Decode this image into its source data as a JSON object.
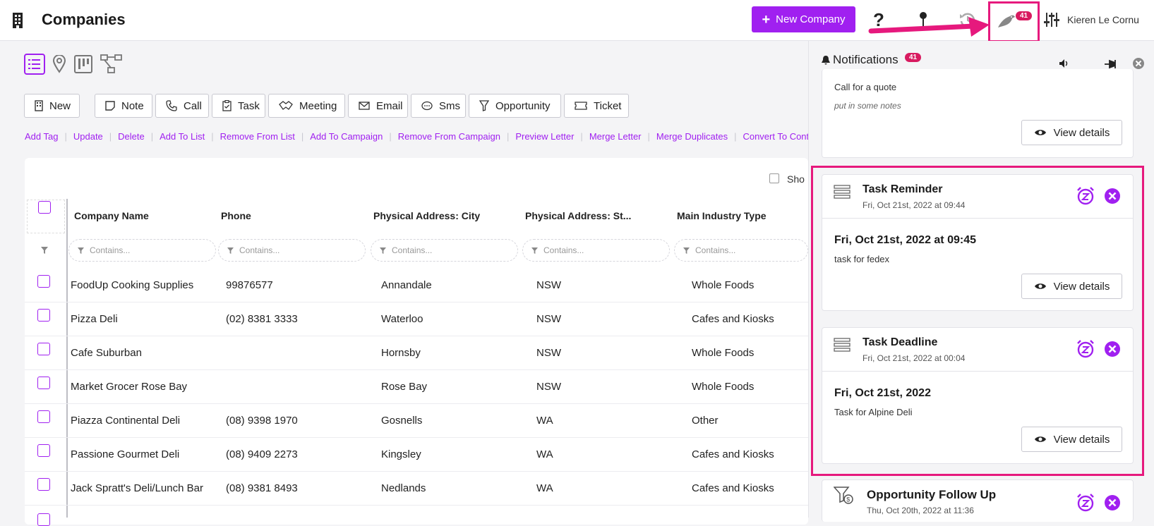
{
  "header": {
    "title": "Companies",
    "new_company_label": "New Company",
    "notification_count": "41",
    "user_name": "Kieren Le Cornu"
  },
  "actions": {
    "buttons": [
      "New",
      "Note",
      "Call",
      "Task",
      "Meeting",
      "Email",
      "Sms",
      "Opportunity",
      "Ticket"
    ],
    "links": [
      "Add Tag",
      "Update",
      "Delete",
      "Add To List",
      "Remove From List",
      "Add To Campaign",
      "Remove From Campaign",
      "Preview Letter",
      "Merge Letter",
      "Merge Duplicates",
      "Convert To Contacts"
    ]
  },
  "table": {
    "show_label": "Sho",
    "columns": [
      "Company Name",
      "Phone",
      "Physical Address: City",
      "Physical Address: St...",
      "Main Industry Type"
    ],
    "filter_placeholder": "Contains...",
    "rows": [
      [
        "FoodUp Cooking Supplies",
        "99876577",
        "Annandale",
        "NSW",
        "Whole Foods"
      ],
      [
        "Pizza Deli",
        "(02) 8381 3333",
        "Waterloo",
        "NSW",
        "Cafes and Kiosks"
      ],
      [
        "Cafe Suburban",
        "",
        "Hornsby",
        "NSW",
        "Whole Foods"
      ],
      [
        "Market Grocer Rose Bay",
        "",
        "Rose Bay",
        "NSW",
        "Whole Foods"
      ],
      [
        "Piazza Continental Deli",
        "(08) 9398 1970",
        "Gosnells",
        "WA",
        "Other"
      ],
      [
        "Passione Gourmet Deli",
        "(08) 9409 2273",
        "Kingsley",
        "WA",
        "Cafes and Kiosks"
      ],
      [
        "Jack Spratt's Deli/Lunch Bar",
        "(08) 9381 8493",
        "Nedlands",
        "WA",
        "Cafes and Kiosks"
      ]
    ]
  },
  "notifications": {
    "title": "Notifications",
    "count": "41",
    "view_details_label": "View details",
    "top_card": {
      "text": "Call for a quote",
      "note": "put in some notes"
    },
    "cards": [
      {
        "title": "Task Reminder",
        "time": "Fri, Oct 21st, 2022 at 09:44",
        "date": "Fri, Oct 21st, 2022 at 09:45",
        "text": "task for fedex"
      },
      {
        "title": "Task Deadline",
        "time": "Fri, Oct 21st, 2022 at 00:04",
        "date": "Fri, Oct 21st, 2022",
        "text": "Task for Alpine Deli"
      }
    ],
    "bottom_card": {
      "title": "Opportunity Follow Up",
      "time": "Thu, Oct 20th, 2022 at 11:36"
    }
  },
  "colors": {
    "accent": "#a020f0",
    "highlight": "#e6197d",
    "badge": "#d81b60"
  }
}
